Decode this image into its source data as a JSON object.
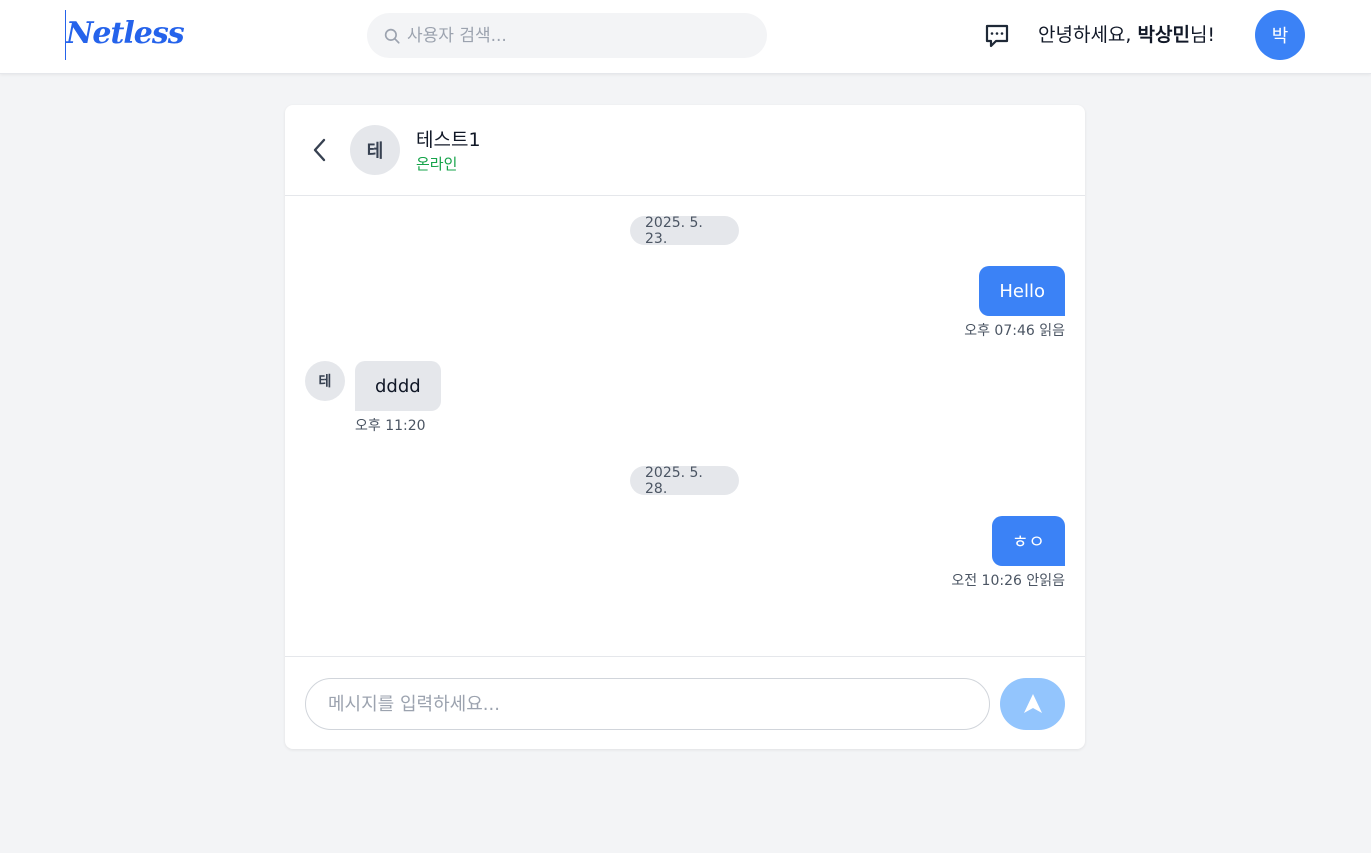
{
  "header": {
    "logo_text": "Netless",
    "search_placeholder": "사용자 검색...",
    "greeting_prefix": "안녕하세요, ",
    "user_name": "박상민",
    "greeting_suffix": "님!",
    "avatar_initial": "박"
  },
  "chat": {
    "partner": {
      "initial": "테",
      "name": "테스트1",
      "status": "온라인"
    },
    "messages": [
      {
        "kind": "date",
        "text": "2025. 5. 23."
      },
      {
        "kind": "sent",
        "text": "Hello",
        "time": "오후 07:46",
        "read_state": "읽음"
      },
      {
        "kind": "received",
        "avatar": "테",
        "text": "dddd",
        "time": "오후 11:20"
      },
      {
        "kind": "date",
        "text": "2025. 5. 28."
      },
      {
        "kind": "sent",
        "text": "ㅎㅇ",
        "time": "오전 10:26",
        "read_state": "안읽음"
      }
    ],
    "composer_placeholder": "메시지를 입력하세요..."
  },
  "colors": {
    "brand": "#2563eb",
    "sent_bubble": "#3b82f6",
    "received_bubble": "#e5e7eb",
    "online": "#16a34a",
    "send_button": "#93c5fd"
  },
  "icons": {
    "search": "search-icon",
    "chat": "chat-bubble-icon",
    "back": "chevron-left-icon",
    "send": "send-arrow-icon"
  }
}
